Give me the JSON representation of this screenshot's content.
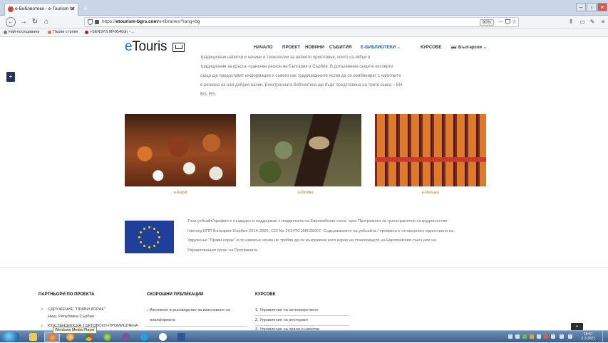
{
  "browser": {
    "tab_title": "e-Библиотеки - e-Tourism Ur",
    "new_tab_label": "+",
    "url_prefix": "https://",
    "url_domain": "etourism-bgrs.com",
    "url_path": "/e-libraries/?lang=bg",
    "zoom": "90%",
    "bookmarks": [
      "Най-посещавани",
      "Първи стъпки",
      "i-SENSYS MF8540dn - ..."
    ]
  },
  "site": {
    "logo_text": "eTouris",
    "menu": [
      "НАЧАЛО",
      "ПРОЕКТ",
      "НОВИНИ",
      "СЪБИТИЯ",
      "Е-БИБЛИОТЕКИ ⌄",
      "КУРСОВЕ",
      "Български ⌄"
    ],
    "intro_lines": [
      "традиционни напитки и начини и технологии за нейното приготвяне, които са зябци в",
      "традиционни за кръста -граничен регион на България и Сърбия. В допълнение сьщите експерти",
      "също ще предоставят информация и съвети как традиционните ястия да се комбинират с напитките",
      "в региона на най-добрия начин. Електронната библиотека ще бъде представена на трите езика – EN,",
      "BG, RS."
    ],
    "cards": [
      {
        "label": "e-Food"
      },
      {
        "label": "e-Drinks"
      },
      {
        "label": "e-Venues"
      }
    ],
    "eu_text_lines": [
      "Този уебсайт/профил е създаден и поддържан с подкрепата на Европейския съюз, чрез Програмата за трансгранично сътрудничество",
      "Interreg-ИПП България-Сърбия 2014-2020, CCI No 2014TC16I5CB007. Съдържанието на уебсайта / профила е отговорност единствено на",
      "Удружење \"Прави корак\" и по никакъв начин не трябва да се възприема като израз на становището на Европейския съюз или на",
      "Управляващия орган на Програмата."
    ]
  },
  "footer": {
    "col1_title": "ПАРТНЬОРИ ПО ПРОЕКТА",
    "col1_items": [
      "СДРУЖЕНИЕ \"ПРАВИ КОРАК\"",
      "Ниш, Република Сърбия",
      "КЮСТЕНДИЛСКА ТЪРГОВСКО-ПРОМИШЛЕНА"
    ],
    "col2_title": "СКОРОШНИ ПУБЛИКАЦИИ",
    "col2_items": [
      "› Изготвено в ръководство за използване на",
      "платформата"
    ],
    "col3_title": "КУРСОВЕ",
    "col3_items": [
      "1. Управление на хотелиерството",
      "2. Управление на ресторант",
      "3. Управление на храни и напитки"
    ]
  },
  "taskbar": {
    "tooltip": "Windows Media Player",
    "clock_time": "18:57",
    "clock_date": "2.3.2021"
  }
}
